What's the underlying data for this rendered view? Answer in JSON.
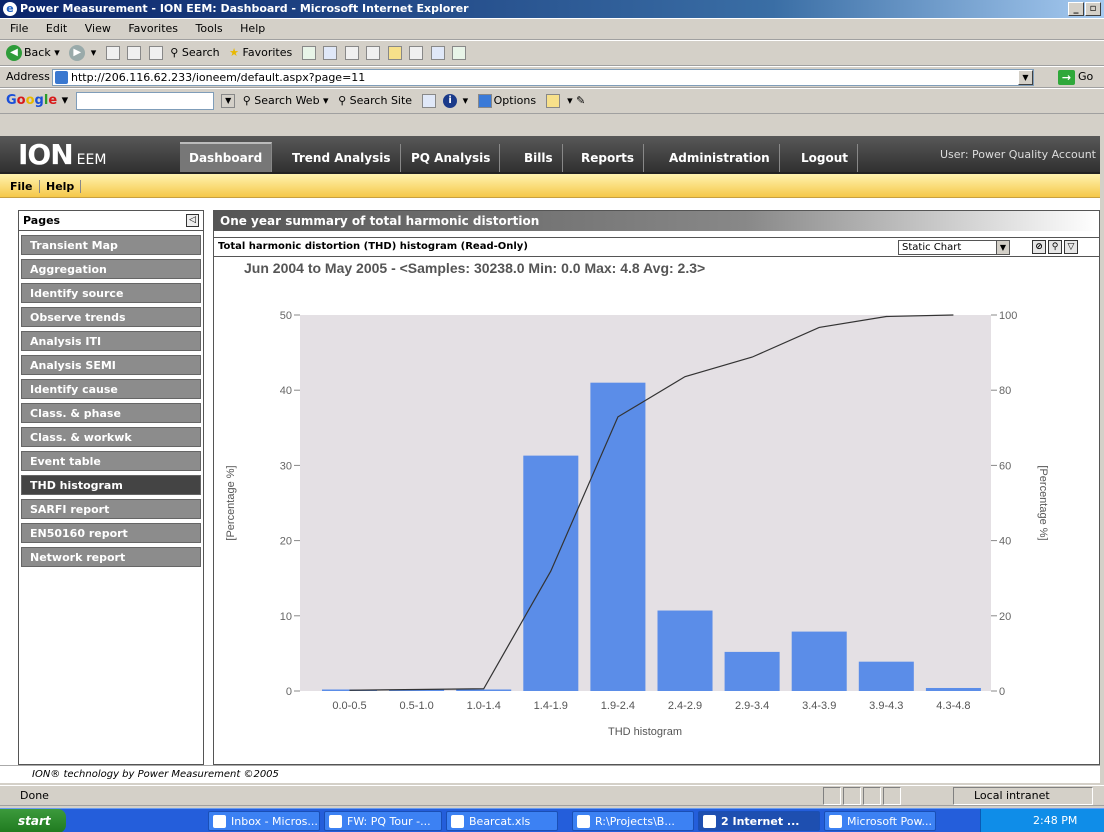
{
  "window": {
    "title": "Power Measurement - ION EEM: Dashboard - Microsoft Internet Explorer"
  },
  "menu": [
    "File",
    "Edit",
    "View",
    "Favorites",
    "Tools",
    "Help"
  ],
  "toolbar": {
    "back": "Back",
    "search": "Search",
    "favorites": "Favorites"
  },
  "address": {
    "label": "Address",
    "url": "http://206.116.62.233/ioneem/default.aspx?page=11",
    "go": "Go"
  },
  "google": {
    "logo": "Google",
    "search_web": "Search Web",
    "search_site": "Search Site",
    "options": "Options"
  },
  "app": {
    "logo": "ION",
    "logo_suffix": "EEM",
    "tabs": [
      "Dashboard",
      "Trend Analysis",
      "PQ Analysis",
      "Bills",
      "Reports",
      "Administration",
      "Logout"
    ],
    "user": "User: Power Quality Account",
    "filemenu": [
      "File",
      "Help"
    ]
  },
  "sidebar": {
    "title": "Pages",
    "items": [
      "Transient Map",
      "Aggregation",
      "Identify source",
      "Observe trends",
      "Analysis ITI",
      "Analysis SEMI",
      "Identify cause",
      "Class. & phase",
      "Class. & workwk",
      "Event table",
      "THD histogram",
      "SARFI report",
      "EN50160 report",
      "Network report"
    ],
    "active_index": 10
  },
  "panel": {
    "title": "One year summary of total harmonic distortion",
    "chart_header": "Total harmonic distortion (THD) histogram (Read-Only)",
    "chart_mode": "Static Chart"
  },
  "chart_data": {
    "type": "bar",
    "title": "Jun 2004 to May 2005 - <Samples: 30238.0 Min: 0.0 Max: 4.8 Avg: 2.3>",
    "xlabel": "THD histogram",
    "ylabel": "[Percentage %]",
    "y2label": "[Percentage %]",
    "categories": [
      "0.0-0.5",
      "0.5-1.0",
      "1.0-1.4",
      "1.4-1.9",
      "1.9-2.4",
      "2.4-2.9",
      "2.9-3.4",
      "3.4-3.9",
      "3.9-4.3",
      "4.3-4.8"
    ],
    "series": [
      {
        "type": "bar",
        "values": [
          0.2,
          0.2,
          0.2,
          31.3,
          41.0,
          10.7,
          5.2,
          7.9,
          3.9,
          0.4
        ],
        "axis": "left"
      },
      {
        "type": "line",
        "values": [
          0.2,
          0.4,
          0.6,
          31.9,
          72.9,
          83.6,
          88.8,
          96.7,
          99.6,
          100.0
        ],
        "axis": "right"
      }
    ],
    "ylim": [
      0,
      50
    ],
    "y2lim": [
      0,
      100
    ],
    "yticks": [
      0,
      10,
      20,
      30,
      40,
      50
    ],
    "y2ticks": [
      0,
      20,
      40,
      60,
      80,
      100
    ],
    "colors": {
      "bar": "#5b8de8",
      "line": "#333333",
      "plot_bg": "#e4e0e4"
    }
  },
  "footer": "ION® technology by Power Measurement ©2005",
  "status": {
    "text": "Done",
    "zone": "Local intranet"
  },
  "taskbar": {
    "start": "start",
    "tasks": [
      "Inbox - Micros...",
      "FW: PQ Tour -...",
      "Bearcat.xls",
      "R:\\Projects\\B...",
      "2 Internet ...",
      "Microsoft Pow..."
    ],
    "clock": "2:48 PM"
  }
}
